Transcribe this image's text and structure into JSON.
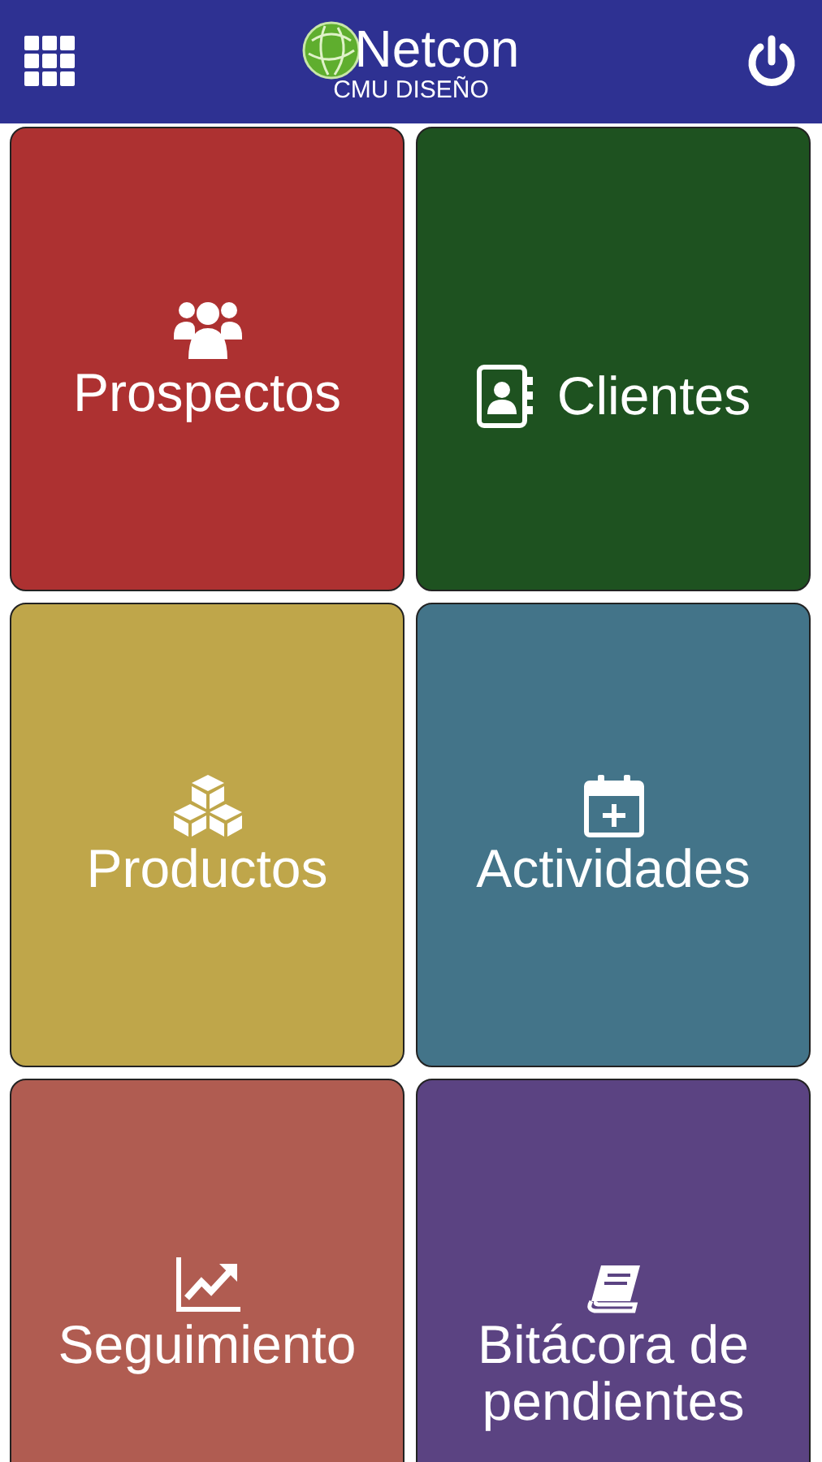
{
  "header": {
    "brand": "Netcon",
    "subtitle": "CMU DISEÑO"
  },
  "tiles": [
    {
      "label": "Prospectos",
      "kind": "people",
      "inline": false,
      "color": "#ad3131"
    },
    {
      "label": "Clientes",
      "kind": "contacts",
      "inline": true,
      "color": "#1e5220"
    },
    {
      "label": "Productos",
      "kind": "cubes",
      "inline": false,
      "color": "#bfa64a"
    },
    {
      "label": "Actividades",
      "kind": "calendar",
      "inline": false,
      "color": "#437489"
    },
    {
      "label": "Seguimiento",
      "kind": "chart",
      "inline": false,
      "color": "#b05c51"
    },
    {
      "label": "Bitácora de pendientes",
      "kind": "book",
      "inline": false,
      "color": "#5b4382"
    }
  ]
}
